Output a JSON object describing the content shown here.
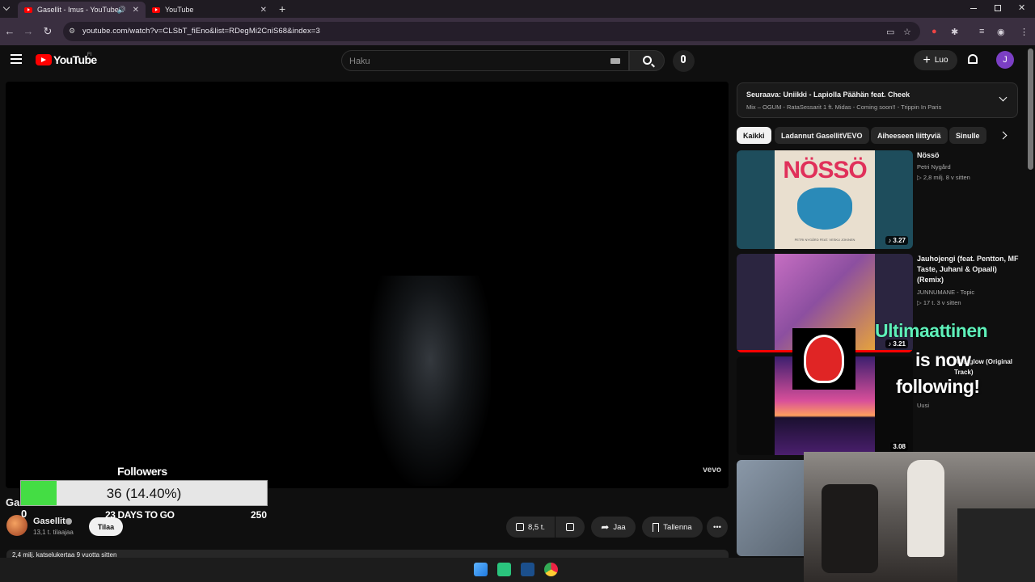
{
  "browser": {
    "tabs": [
      {
        "title": "Gasellit - Imus - YouTube",
        "active": true
      },
      {
        "title": "YouTube",
        "active": false
      }
    ],
    "url": "youtube.com/watch?v=CLSbT_fiEno&list=RDegMi2CniS68&index=3"
  },
  "header": {
    "logo_text": "YouTube",
    "region": "FI",
    "search_placeholder": "Haku",
    "create_label": "Luo",
    "avatar_letter": "J"
  },
  "video": {
    "watermark": "vevo",
    "title": "Gasellit - Imus",
    "channel": "Gasellit",
    "subscribers": "13,1 t. tilaajaa",
    "subscribe_label": "Tilaa",
    "likes": "8,5 t.",
    "share_label": "Jaa",
    "save_label": "Tallenna",
    "views_line": "2,4 milj. katselukertaa  9 vuotta sitten"
  },
  "sidebar": {
    "up_next_title": "Seuraava: Uniikki - Lapiolla Päähän feat. Cheek",
    "up_next_sub": "Mix – OGUM - RataSessarit 1 ft. Midas - Coming soon!! - Trippin In Paris",
    "chips": [
      "Kaikki",
      "Ladannut GasellitVEVO",
      "Aiheeseen liittyviä",
      "Sinulle"
    ],
    "videos": [
      {
        "title": "Nössö",
        "channel": "Petri Nygård",
        "meta": "▷ 2,8 milj.   8 v sitten",
        "duration": "♪ 3.27"
      },
      {
        "title": "Jauhojengi (feat. Pentton, MF Taste, Juhani & Opaali) (Remix)",
        "channel": "JUNNUMANE - Topic",
        "meta": "▷ 17 t.   3 v sitten",
        "duration": "♪ 3.21"
      },
      {
        "title": "Afterglow (Original Track)",
        "channel": "",
        "meta": "Uusi",
        "duration": "3.08"
      }
    ],
    "thumb_text": {
      "nosso": "NÖSSÖ",
      "nosso_credit": "PETRI NYGÅRD FEAT. VESKU JOKINEN"
    }
  },
  "overlays": {
    "followers_label": "Followers",
    "followers_value": "36 (14.40%)",
    "followers_fraction": 0.144,
    "min": "0",
    "days": "23 DAYS TO GO",
    "max": "250",
    "alert_name": "Ultimaattinen",
    "alert_line1": "is now",
    "alert_line2": "following!"
  },
  "colors": {
    "accent": "#ff0000",
    "progress": "#44dd44",
    "alert": "#5ef0b9"
  }
}
